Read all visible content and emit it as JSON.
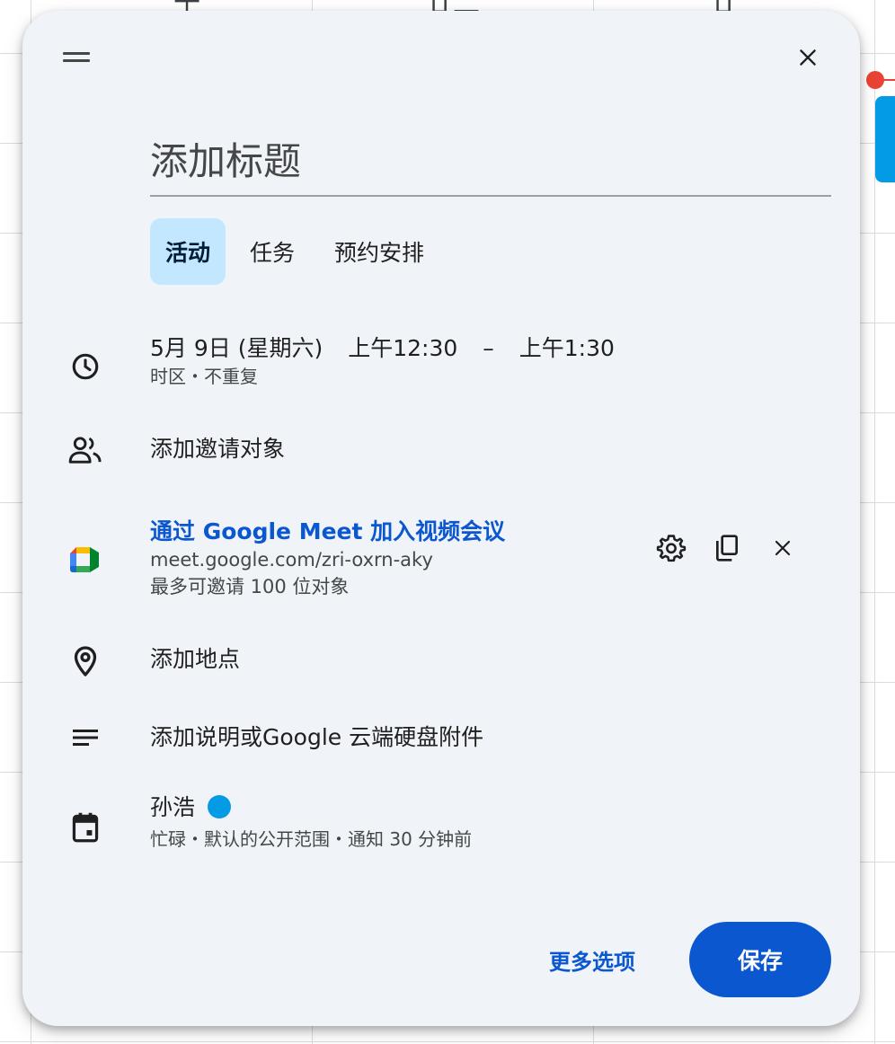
{
  "background": {
    "header_glyphs": [
      "十",
      "廿二",
      "廿"
    ]
  },
  "dialog": {
    "title_placeholder": "添加标题",
    "tabs": [
      {
        "label": "活动",
        "active": true
      },
      {
        "label": "任务",
        "active": false
      },
      {
        "label": "预约安排",
        "active": false
      }
    ],
    "datetime": {
      "date": "5月 9日 (星期六)",
      "start": "上午12:30",
      "separator": "–",
      "end": "上午1:30",
      "sub": "时区・不重复"
    },
    "guests": {
      "label": "添加邀请对象"
    },
    "meet": {
      "join_label": "通过 Google Meet 加入视频会议",
      "url": "meet.google.com/zri-oxrn-aky",
      "limit": "最多可邀请 100 位对象"
    },
    "location": {
      "label": "添加地点"
    },
    "description": {
      "label": "添加说明或Google 云端硬盘附件"
    },
    "calendar": {
      "owner": "孙浩",
      "color": "#039be5",
      "details": "忙碌・默认的公开范围・通知 30 分钟前"
    },
    "footer": {
      "more_options": "更多选项",
      "save": "保存"
    }
  },
  "colors": {
    "primary": "#0b57d0",
    "tab_active": "#c2e7ff",
    "dialog_bg": "#f0f4f9",
    "current_time": "#ea4335"
  }
}
